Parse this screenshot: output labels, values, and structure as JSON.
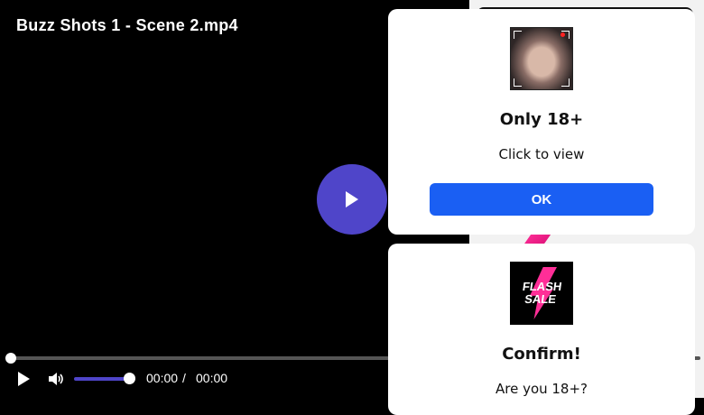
{
  "video": {
    "title": "Buzz Shots 1 - Scene 2.mp4",
    "current_time": "00:00",
    "separator": "/",
    "duration": "00:00",
    "progress": 0,
    "volume": 1.0,
    "accent_color": "#4f45c9"
  },
  "popup_age": {
    "thumbnail_icon": "adult-thumbnail",
    "title": "Only 18+",
    "subtitle": "Click to view",
    "button_label": "OK",
    "button_color": "#1a5ff3"
  },
  "popup_confirm": {
    "thumbnail_text_line1": "FLASH",
    "thumbnail_text_line2": "SALE",
    "thumbnail_accent": "#ff2e97",
    "title": "Confirm!",
    "subtitle": "Are you 18+?"
  }
}
